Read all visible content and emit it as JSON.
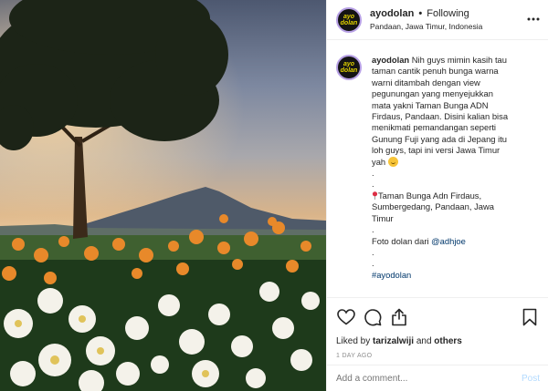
{
  "post": {
    "username": "ayodolan",
    "separator": "•",
    "follow_status": "Following",
    "location": "Pandaan, Jawa Timur, Indonesia",
    "avatar_text": "ayo dolan"
  },
  "caption": {
    "username": "ayodolan",
    "lines": [
      "Nih guys mimin kasih tau",
      "taman cantik penuh bunga warna",
      "warni ditambah dengan view",
      "pegunungan yang menyejukkan",
      "mata yakni Taman Bunga ADN",
      "Firdaus, Pandaan. Disini kalian bisa",
      "menikmati pemandangan seperti",
      "Gunung Fuji yang ada di Jepang itu",
      "loh guys, tapi ini versi Jawa Timur"
    ],
    "last_word": "yah",
    "dots": [
      ".",
      "."
    ],
    "address_lines": [
      "Taman Bunga Adn Firdaus,",
      "Sumbergedang, Pandaan, Jawa",
      "Timur"
    ],
    "dot_after_address": ".",
    "credit_prefix": "Foto dolan dari",
    "credit_mention": "@adhjoe",
    "dots_after_credit": [
      ".",
      "."
    ],
    "hashtag": "#ayodolan"
  },
  "actions": {
    "liked_prefix": "Liked by",
    "liked_user": "tarizalwiji",
    "liked_and": "and",
    "liked_others": "others",
    "timestamp": "1 DAY AGO",
    "comment_placeholder": "Add a comment...",
    "post_label": "Post"
  },
  "icons": {
    "more": "more-options-icon",
    "like": "heart-icon",
    "comment": "comment-icon",
    "share": "share-icon",
    "save": "bookmark-icon",
    "pin": "round-pushpin-icon",
    "emoji": "grinning-face-icon"
  },
  "colors": {
    "text": "#262626",
    "link": "#00376b",
    "meta": "#8e8e8e",
    "post_button": "#b3dbff",
    "border": "#efefef"
  }
}
